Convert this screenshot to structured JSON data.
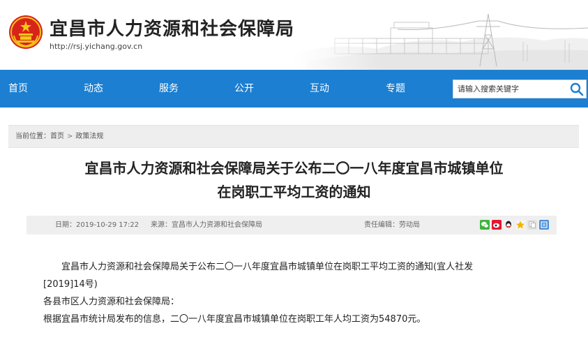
{
  "header": {
    "site_title": "宜昌市人力资源和社会保障局",
    "site_url": "http://rsj.yichang.gov.cn"
  },
  "nav": {
    "items": [
      "首页",
      "动态",
      "服务",
      "公开",
      "互动",
      "专题"
    ]
  },
  "search": {
    "placeholder": "请输入搜索关键字",
    "button_icon": "search-icon"
  },
  "breadcrumb": {
    "label": "当前位置：",
    "items": [
      "首页",
      "政策法规"
    ],
    "separator": ">"
  },
  "article": {
    "title_line1": "宜昌市人力资源和社会保障局关于公布二〇一八年度宜昌市城镇单位",
    "title_line2": "在岗职工平均工资的通知"
  },
  "meta": {
    "date": "日期：2019-10-29 17:22",
    "source": "来源：宜昌市人力资源和社会保障局",
    "editor": "责任编辑：劳动局",
    "share_icons": [
      "wechat-icon",
      "weibo-icon",
      "qq-icon",
      "qzone-icon",
      "copy-icon",
      "favorite-icon"
    ]
  },
  "body": {
    "para1_line1": "宜昌市人力资源和社会保障局关于公布二〇一八年度宜昌市城镇单位在岗职工平均工资的通知(宜人社发",
    "para1_line2": "[2019]14号)",
    "para2": "各县市区人力资源和社会保障局：",
    "para3": "根据宜昌市统计局发布的信息，二〇一八年度宜昌市城镇单位在岗职工年人均工资为54870元。"
  },
  "colors": {
    "nav_bg": "#1c7fd1",
    "emblem_red": "#d7241a",
    "emblem_gold": "#f5c518"
  }
}
